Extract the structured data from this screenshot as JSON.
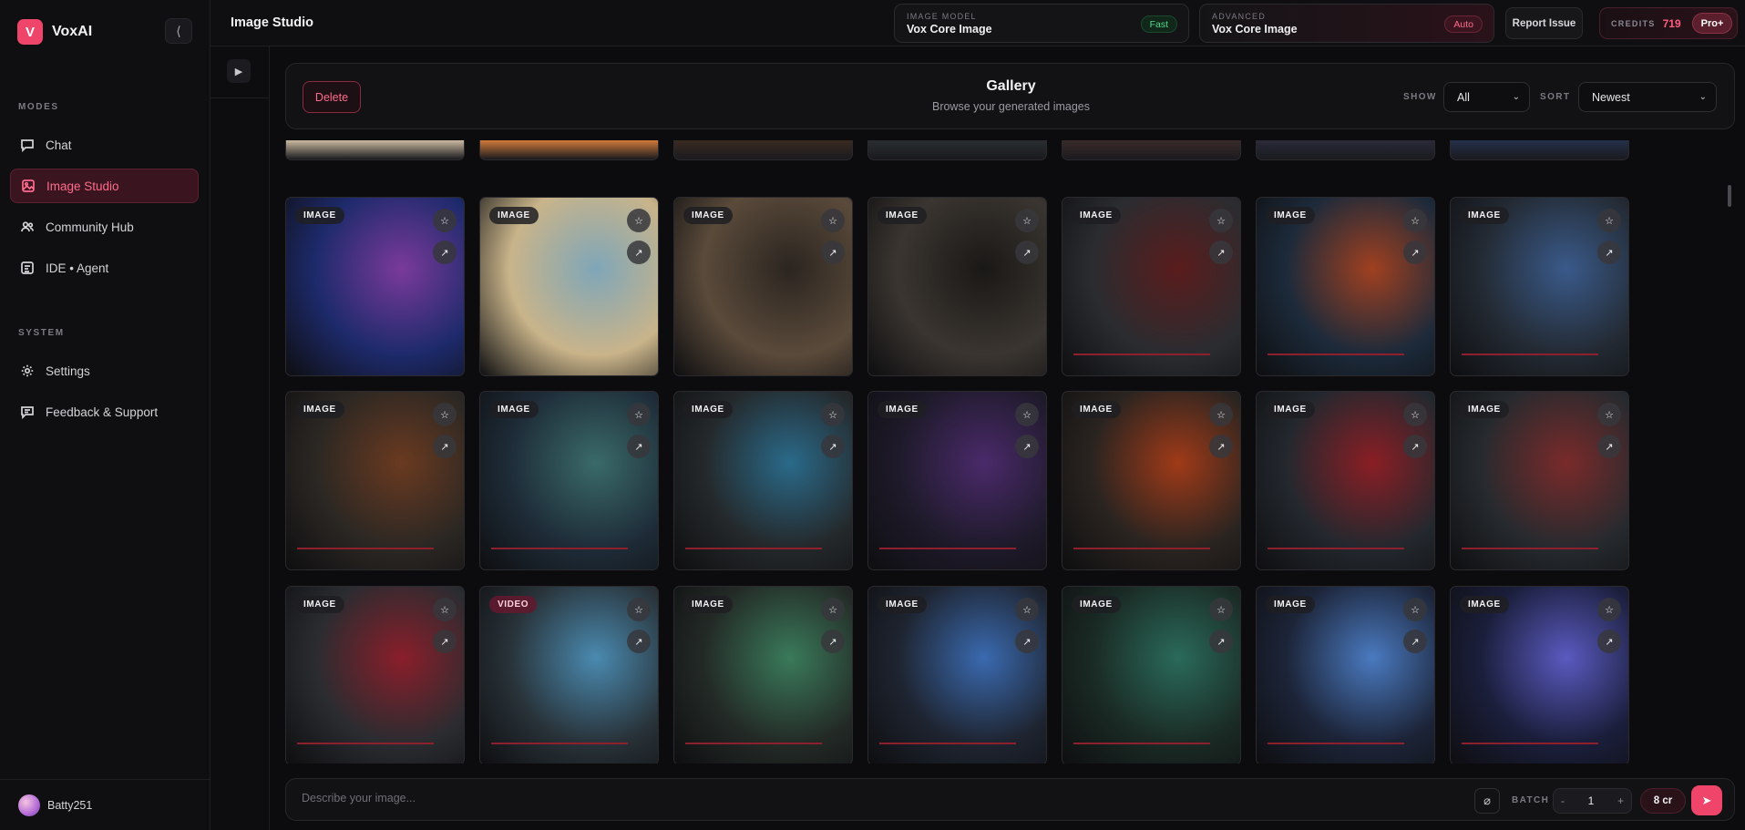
{
  "brand": {
    "badge": "V",
    "name": "VoxAI"
  },
  "sidebar": {
    "collapse_icon": "chevron-left-icon",
    "modes_title": "MODES",
    "modes": [
      {
        "label": "Chat",
        "icon": "chat-icon"
      },
      {
        "label": "Image Studio",
        "icon": "image-icon",
        "active": true
      },
      {
        "label": "Community Hub",
        "icon": "users-icon"
      },
      {
        "label": "IDE • Agent",
        "icon": "ide-icon"
      }
    ],
    "system_title": "SYSTEM",
    "system": [
      {
        "label": "Settings",
        "icon": "gear-icon"
      },
      {
        "label": "Feedback & Support",
        "icon": "message-icon"
      }
    ],
    "user": "Batty251"
  },
  "topbar": {
    "title": "Image Studio",
    "image_model_label": "IMAGE MODEL",
    "image_model_value": "Vox Core Image",
    "image_model_pill": "Fast",
    "advanced_label": "ADVANCED",
    "advanced_value": "Vox Core Image",
    "advanced_pill": "Auto",
    "report_button": "Report Issue",
    "credits_label": "CREDITS",
    "credits_value": "719",
    "plan_badge": "Pro+"
  },
  "gallery": {
    "delete_button": "Delete",
    "title": "Gallery",
    "subtitle": "Browse your generated images",
    "show_label": "SHOW",
    "show_value": "All",
    "sort_label": "SORT",
    "sort_value": "Newest",
    "tiles": [
      {
        "type": "IMAGE",
        "colors": [
          "#1d2a6b",
          "#7a3a9a"
        ]
      },
      {
        "type": "IMAGE",
        "colors": [
          "#c9b48a",
          "#7fa6b8"
        ]
      },
      {
        "type": "IMAGE",
        "colors": [
          "#5a4a3a",
          "#2b2520"
        ]
      },
      {
        "type": "IMAGE",
        "colors": [
          "#3a3530",
          "#1a1816"
        ]
      },
      {
        "type": "IMAGE",
        "colors": [
          "#2a2c30",
          "#5a1c1c"
        ]
      },
      {
        "type": "IMAGE",
        "colors": [
          "#1c2a3a",
          "#a04020"
        ]
      },
      {
        "type": "IMAGE",
        "colors": [
          "#232a33",
          "#3a5a8a"
        ]
      },
      {
        "type": "IMAGE",
        "colors": [
          "#2b2723",
          "#6a3a20"
        ]
      },
      {
        "type": "IMAGE",
        "colors": [
          "#1e2c38",
          "#3a6a6a"
        ]
      },
      {
        "type": "IMAGE",
        "colors": [
          "#24282a",
          "#2a6a8a"
        ]
      },
      {
        "type": "IMAGE",
        "colors": [
          "#1e1a2a",
          "#4a2a6a"
        ]
      },
      {
        "type": "IMAGE",
        "colors": [
          "#2a2420",
          "#a03a18"
        ]
      },
      {
        "type": "IMAGE",
        "colors": [
          "#23282e",
          "#8a1e24"
        ]
      },
      {
        "type": "IMAGE",
        "colors": [
          "#262a2e",
          "#7a2a2a"
        ]
      },
      {
        "type": "IMAGE",
        "colors": [
          "#2a2c30",
          "#8a1e2a"
        ]
      },
      {
        "type": "VIDEO",
        "colors": [
          "#283238",
          "#4a8ab0"
        ]
      },
      {
        "type": "IMAGE",
        "colors": [
          "#232a26",
          "#3a7a5a"
        ]
      },
      {
        "type": "IMAGE",
        "colors": [
          "#1e2430",
          "#3a6ab0"
        ]
      },
      {
        "type": "IMAGE",
        "colors": [
          "#1a2a24",
          "#2a6a5a"
        ]
      },
      {
        "type": "IMAGE",
        "colors": [
          "#1c2438",
          "#4a7ac0"
        ]
      },
      {
        "type": "IMAGE",
        "colors": [
          "#1a1e3a",
          "#5a5ac0"
        ]
      }
    ],
    "strip_colors": [
      "#cbb9a0",
      "#d07a3a",
      "#3a2a20",
      "#2a2e30",
      "#3a2a2a",
      "#2a2a3a",
      "#24304a"
    ]
  },
  "prompt": {
    "placeholder": "Describe your image...",
    "attach_icon": "paperclip-icon",
    "batch_label": "BATCH",
    "batch_value": "1",
    "minus": "-",
    "plus": "+",
    "cost": "8 cr",
    "send_icon": "send-icon"
  },
  "colors": {
    "accent": "#f0456b",
    "background": "#0c0c0e",
    "panel": "#121215"
  }
}
